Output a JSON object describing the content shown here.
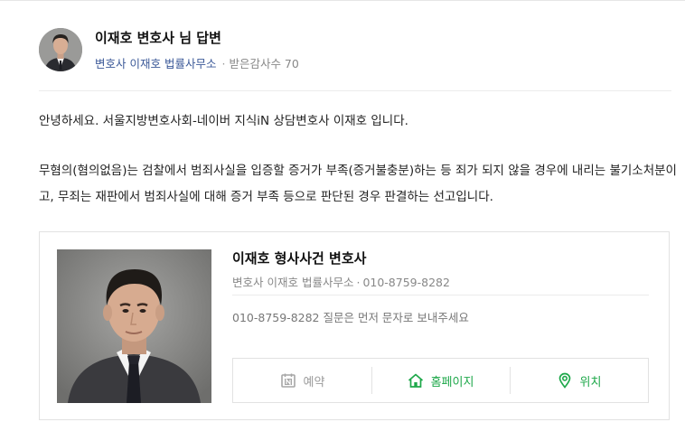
{
  "answer": {
    "author_name": "이재호 변호사 님 답변",
    "office": "변호사 이재호 법률사무소",
    "thanks_count": "받은감사수 70"
  },
  "content": {
    "paragraph1": "안녕하세요. 서울지방변호사회-네이버 지식iN 상담변호사 이재호 입니다.",
    "paragraph2": "무혐의(혐의없음)는 검찰에서 범죄사실을 입증할 증거가 부족(증거불충분)하는 등 죄가 되지 않을 경우에 내리는 불기소처분이고, 무죄는 재판에서 범죄사실에 대해 증거 부족 등으로 판단된 경우 판결하는 선고입니다."
  },
  "profile_card": {
    "title": "이재호 형사사건 변호사",
    "office": "변호사 이재호 법률사무소",
    "phone": "010-8759-8282",
    "description": "010-8759-8282 질문은 먼저 문자로 보내주세요",
    "actions": {
      "reserve": "예약",
      "homepage": "홈페이지",
      "location": "위치"
    },
    "colors": {
      "active": "#1ea84a",
      "disabled": "#9a9a9a"
    }
  },
  "icons": [
    "avatar-photo",
    "profile-photo",
    "calendar-n-icon",
    "home-icon",
    "location-pin-icon"
  ]
}
